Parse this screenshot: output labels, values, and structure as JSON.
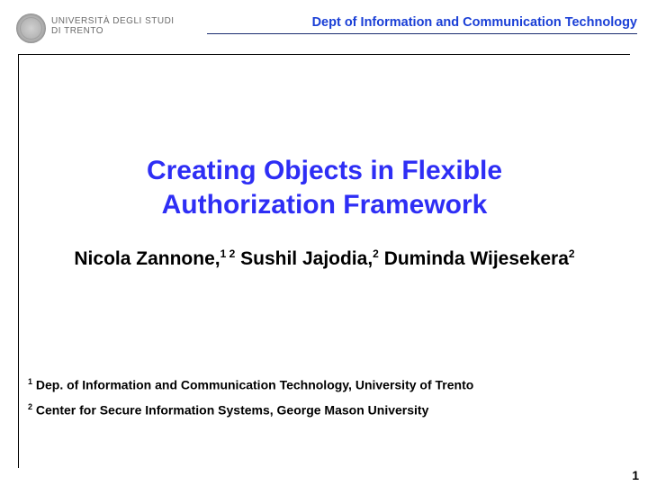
{
  "header": {
    "logo_line1": "UNIVERSITÀ DEGLI STUDI",
    "logo_line2": "DI TRENTO",
    "dept": "Dept of Information and Communication Technology"
  },
  "slide": {
    "title_line1": "Creating Objects in Flexible",
    "title_line2": "Authorization Framework",
    "author1_name": "Nicola Zannone,",
    "author1_sup": "1 2",
    "author2_name": "Sushil Jajodia,",
    "author2_sup": "2",
    "author3_name": "Duminda Wijesekera",
    "author3_sup": "2",
    "affil1_sup": "1",
    "affil1_text": " Dep. of Information and Communication Technology, University of Trento",
    "affil2_sup": "2",
    "affil2_text": " Center for Secure Information Systems, George Mason University",
    "page_number": "1"
  }
}
